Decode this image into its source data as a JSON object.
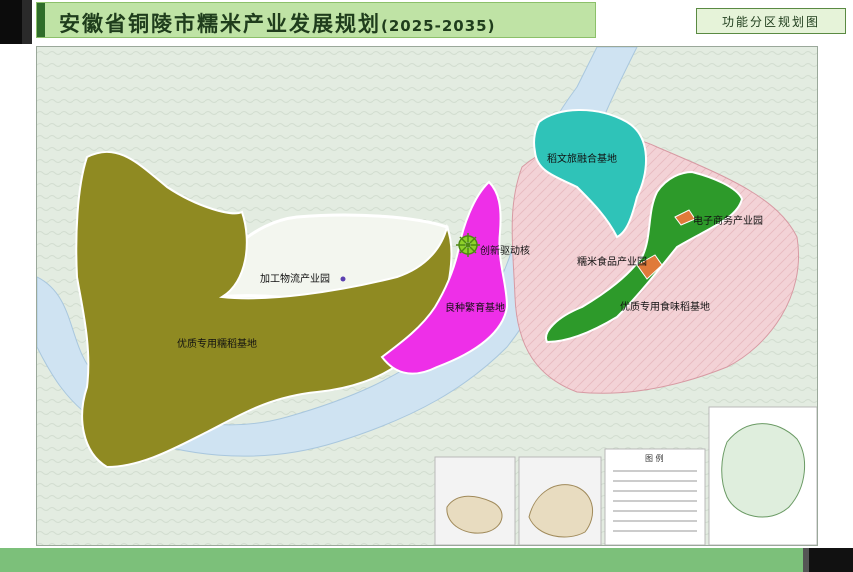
{
  "header": {
    "title": "安徽省铜陵市糯米产业发展规划",
    "years": "(2025-2035)",
    "subtitle": "功能分区规划图"
  },
  "map": {
    "zones": [
      {
        "name": "优质专用糯稻基地",
        "color": "#8f8a22"
      },
      {
        "name": "加工物流产业园",
        "color": "#5b3fb0"
      },
      {
        "name": "良种繁育基地",
        "color": "#ee2fe8"
      },
      {
        "name": "创新驱动核",
        "color": "#8ed02a"
      },
      {
        "name": "稻文旅融合基地",
        "color": "#2fc3b8"
      },
      {
        "name": "电子商务产业园",
        "color": "#e07a3a"
      },
      {
        "name": "糯米食品产业园",
        "color": "#e07a3a"
      },
      {
        "name": "优质专用食味稻基地",
        "color": "#2d9a2a"
      }
    ],
    "legend_title": "图 例"
  }
}
